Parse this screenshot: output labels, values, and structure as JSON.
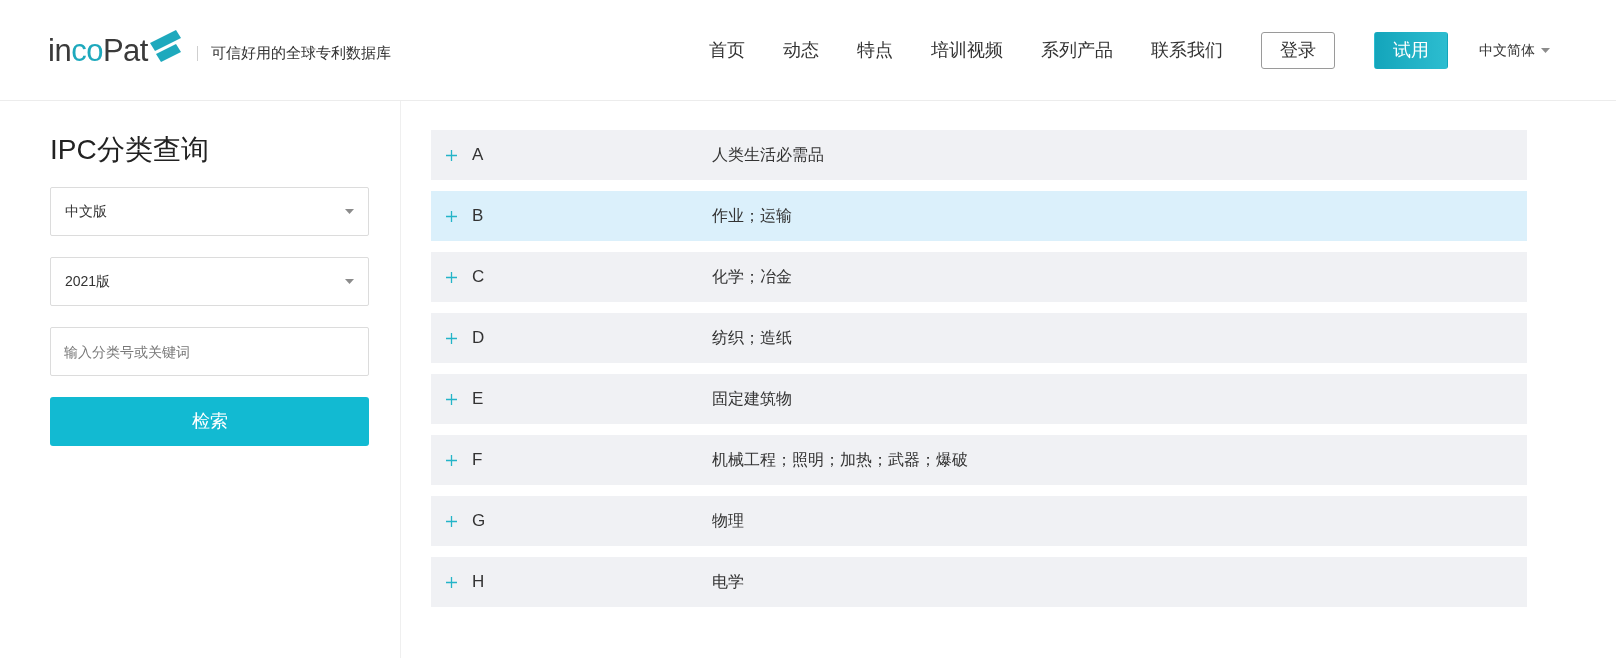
{
  "header": {
    "logo": [
      {
        "text": "in",
        "accent": false
      },
      {
        "text": "co",
        "accent": true
      },
      {
        "text": "Pat",
        "accent": false
      }
    ],
    "tagline": "可信好用的全球专利数据库",
    "nav": [
      "首页",
      "动态",
      "特点",
      "培训视频",
      "系列产品",
      "联系我们"
    ],
    "buttons": [
      {
        "label": "登录",
        "kind": "outline"
      },
      {
        "label": "试用",
        "kind": "filled"
      }
    ],
    "language": "中文简体"
  },
  "sidebar": {
    "title": "IPC分类查询",
    "selects": [
      {
        "value": "中文版"
      },
      {
        "value": "2021版"
      }
    ],
    "search": {
      "placeholder": "输入分类号或关键词"
    },
    "button": "检索"
  },
  "categories": [
    {
      "code": "A",
      "title": "人类生活必需品",
      "selected": false,
      "expanded": false
    },
    {
      "code": "B",
      "title": "作业；运输",
      "selected": true,
      "expanded": false
    },
    {
      "code": "C",
      "title": "化学；冶金",
      "selected": false,
      "expanded": false
    },
    {
      "code": "D",
      "title": "纺织；造纸",
      "selected": false,
      "expanded": false
    },
    {
      "code": "E",
      "title": "固定建筑物",
      "selected": false,
      "expanded": false
    },
    {
      "code": "F",
      "title": "机械工程；照明；加热；武器；爆破",
      "selected": false,
      "expanded": false
    },
    {
      "code": "G",
      "title": "物理",
      "selected": false,
      "expanded": false
    },
    {
      "code": "H",
      "title": "电学",
      "selected": false,
      "expanded": false
    }
  ]
}
